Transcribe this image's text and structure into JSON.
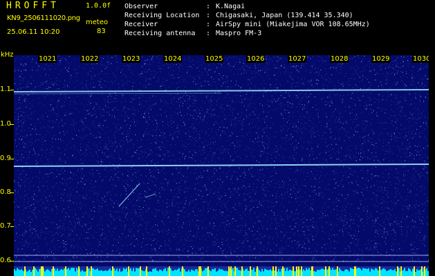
{
  "header": {
    "app_title": "HROFFT",
    "version": "1.0.0f",
    "filename": "KN9_2506111020.png",
    "datetime": "25.06.11 10:20",
    "meteor_label": "meteo",
    "meteor_count": "83"
  },
  "info": [
    {
      "key": "Observer",
      "sep": ":",
      "value": "K.Nagai"
    },
    {
      "key": "Receiving Location",
      "sep": ":",
      "value": "Chigasaki, Japan (139.414 35.340)"
    },
    {
      "key": "Receiver",
      "sep": ":",
      "value": "AirSpy mini (Miakejima VOR 108.65MHz)"
    },
    {
      "key": "Receiving antenna",
      "sep": ":",
      "value": "Maspro FM-3"
    }
  ],
  "axis": {
    "unit": "kHz",
    "y_labels": [
      "1.1",
      "1.0",
      "0.9",
      "0.8",
      "0.7",
      "0.6"
    ],
    "minute_labels": [
      "1021",
      "1022",
      "1023",
      "1024",
      "1025",
      "1026",
      "1027",
      "1028",
      "1029",
      "1030"
    ]
  },
  "colors": {
    "background": "#040a6a",
    "label": "#ffff00",
    "signal": "#9fe8ff",
    "bottom_bar": "#00e5ff"
  }
}
